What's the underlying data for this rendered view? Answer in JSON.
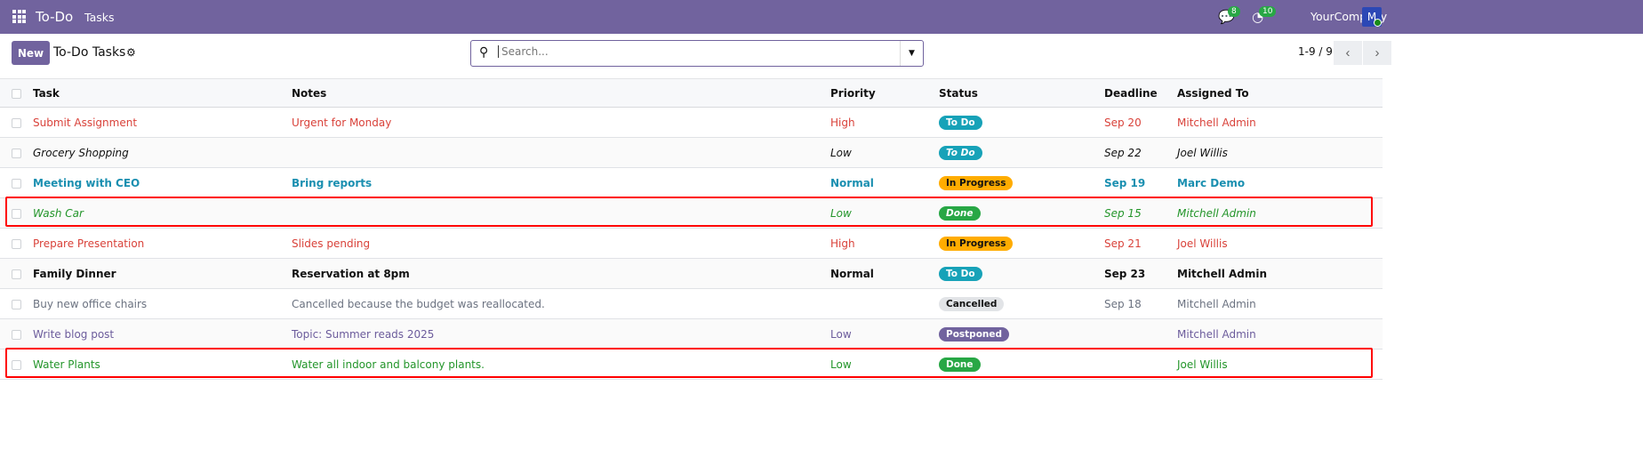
{
  "nav": {
    "app": "To-Do",
    "menu": "Tasks",
    "messages_count": "8",
    "activities_count": "10",
    "company": "YourCompany",
    "avatar": "M"
  },
  "toolbar": {
    "new_label": "New",
    "title": "To-Do Tasks",
    "search_placeholder": "Search...",
    "pager": "1-9 / 9"
  },
  "columns": [
    "Task",
    "Notes",
    "Priority",
    "Status",
    "Deadline",
    "Assigned To"
  ],
  "rows": [
    {
      "task": "Submit Assignment",
      "notes": "Urgent for Monday",
      "priority": "High",
      "status": "To Do",
      "status_color": "#17a2b8",
      "deadline": "Sep 20",
      "assigned": "Mitchell Admin"
    },
    {
      "task": "Grocery Shopping",
      "notes": "",
      "priority": "Low",
      "status": "To Do",
      "status_color": "#17a2b8",
      "deadline": "Sep 22",
      "assigned": "Joel Willis"
    },
    {
      "task": "Meeting with CEO",
      "notes": "Bring reports",
      "priority": "Normal",
      "status": "In Progress",
      "status_color": "#ffac00",
      "deadline": "Sep 19",
      "assigned": "Marc Demo"
    },
    {
      "task": "Wash Car",
      "notes": "",
      "priority": "Low",
      "status": "Done",
      "status_color": "#28a745",
      "deadline": "Sep 15",
      "assigned": "Mitchell Admin"
    },
    {
      "task": "Prepare Presentation",
      "notes": "Slides pending",
      "priority": "High",
      "status": "In Progress",
      "status_color": "#ffac00",
      "deadline": "Sep 21",
      "assigned": "Joel Willis"
    },
    {
      "task": "Family Dinner",
      "notes": "Reservation at 8pm",
      "priority": "Normal",
      "status": "To Do",
      "status_color": "#17a2b8",
      "deadline": "Sep 23",
      "assigned": "Mitchell Admin"
    },
    {
      "task": "Buy new office chairs",
      "notes": "Cancelled because the budget was reallocated.",
      "priority": "",
      "status": "Cancelled",
      "status_color": "#e2e4e7",
      "deadline": "Sep 18",
      "assigned": "Mitchell Admin"
    },
    {
      "task": "Write blog post",
      "notes": "Topic: Summer reads 2025",
      "priority": "Low",
      "status": "Postponed",
      "status_color": "#71639e",
      "deadline": "",
      "assigned": "Mitchell Admin"
    },
    {
      "task": "Water Plants",
      "notes": "Water all indoor and balcony plants.",
      "priority": "Low",
      "status": "Done",
      "status_color": "#28a745",
      "deadline": "",
      "assigned": "Joel Willis"
    }
  ]
}
